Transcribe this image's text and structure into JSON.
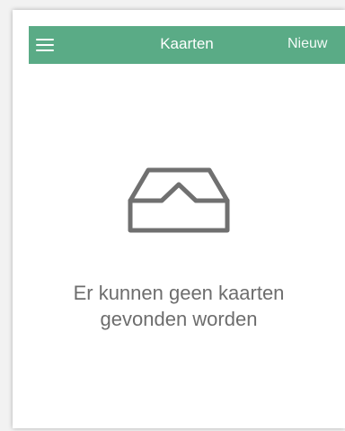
{
  "header": {
    "title": "Kaarten",
    "new_label": "Nieuw"
  },
  "empty_state": {
    "icon": "inbox-icon",
    "message": "Er kunnen geen kaarten gevonden worden"
  },
  "colors": {
    "header_background": "#5aab86",
    "header_text": "#ffffff",
    "message_text": "#6d6d6d",
    "icon_stroke": "#707070"
  }
}
